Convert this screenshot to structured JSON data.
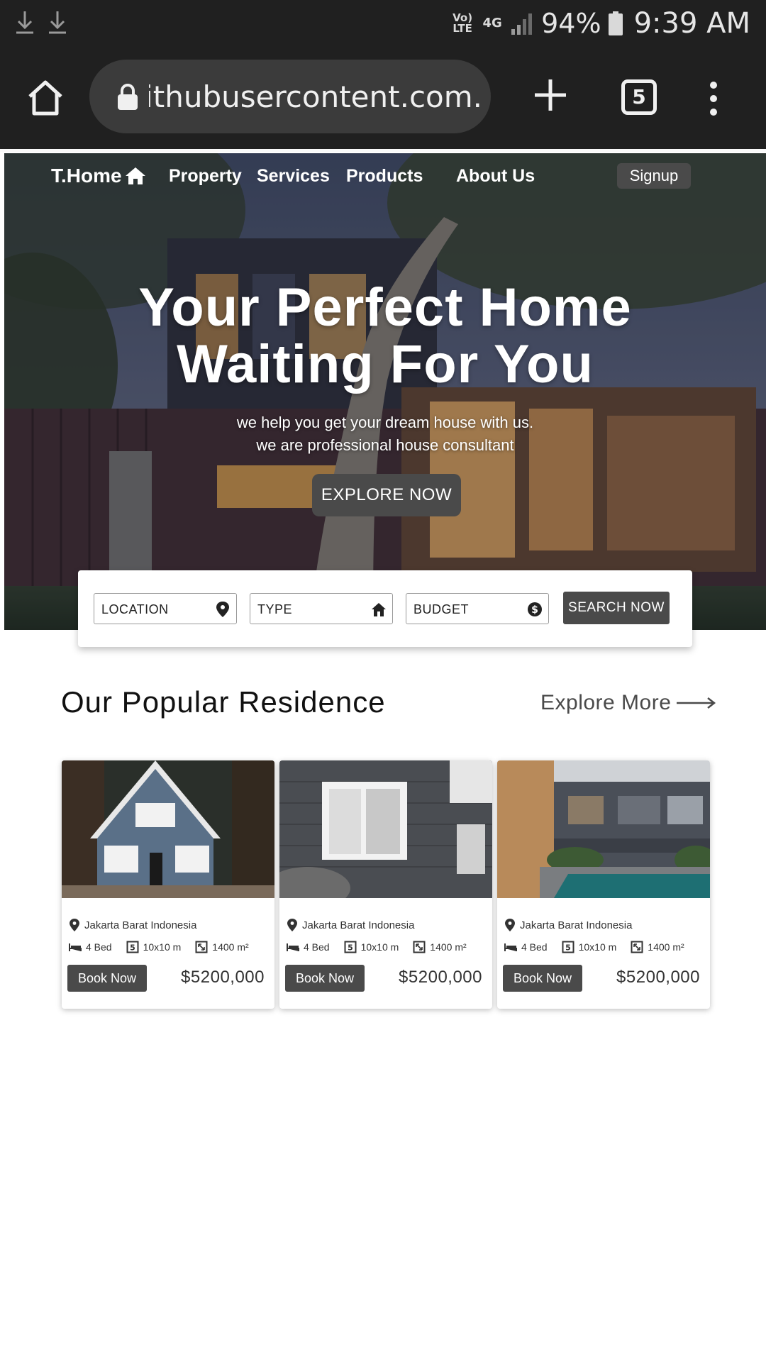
{
  "status_bar": {
    "volte": "Vo) LTE",
    "network": "4G",
    "battery": "94%",
    "time": "9:39 AM"
  },
  "browser": {
    "url": ".githubusercontent.com",
    "tab_count": "5"
  },
  "nav": {
    "brand": "T.Home",
    "links": [
      "Property",
      "Services",
      "Products",
      "About Us"
    ],
    "signup": "Signup"
  },
  "hero": {
    "title_line1": "Your Perfect Home",
    "title_line2": "Waiting For You",
    "subtitle_line1": "we help you get your dream house with us.",
    "subtitle_line2": "we are professional house consultant",
    "cta": "EXPLORE NOW"
  },
  "search": {
    "location": "LOCATION",
    "type": "TYPE",
    "budget": "BUDGET",
    "button": "SEARCH NOW"
  },
  "residence": {
    "title": "Our Popular Residence",
    "explore_more": "Explore More",
    "cards": [
      {
        "location": "Jakarta Barat Indonesia",
        "beds": "4 Bed",
        "size": "10x10 m",
        "area": "1400 m²",
        "book": "Book Now",
        "price": "$5200,000"
      },
      {
        "location": "Jakarta Barat Indonesia",
        "beds": "4 Bed",
        "size": "10x10 m",
        "area": "1400 m²",
        "book": "Book Now",
        "price": "$5200,000"
      },
      {
        "location": "Jakarta Barat Indonesia",
        "beds": "4 Bed",
        "size": "10x10 m",
        "area": "1400 m²",
        "book": "Book Now",
        "price": "$5200,000"
      }
    ]
  },
  "colors": {
    "status_bg": "#202020",
    "accent_dark": "#4a4a4a",
    "url_pill": "#3b3b3b"
  }
}
